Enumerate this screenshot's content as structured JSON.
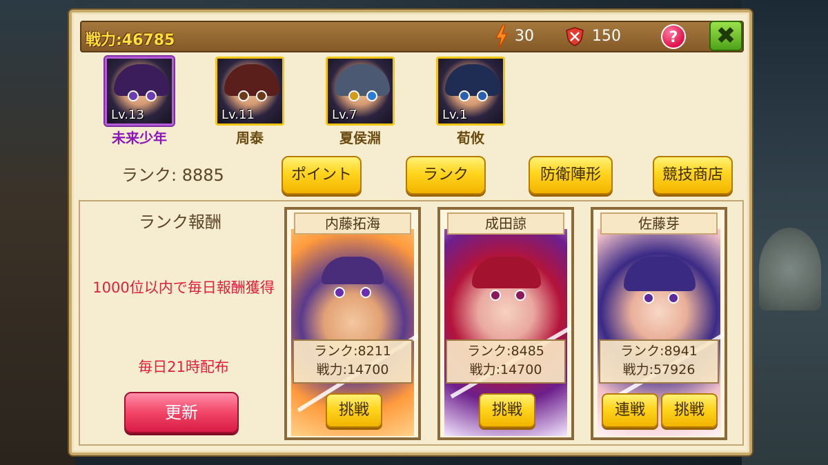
{
  "header": {
    "power_label": "戦力:46785",
    "energy": "30",
    "tickets": "150",
    "help_label": "?",
    "close_label": "✖"
  },
  "heroes": [
    {
      "level": "Lv.13",
      "name": "未来少年",
      "selected": true
    },
    {
      "level": "Lv.11",
      "name": "周泰",
      "selected": false
    },
    {
      "level": "Lv.7",
      "name": "夏侯淵",
      "selected": false
    },
    {
      "level": "Lv.1",
      "name": "荀攸",
      "selected": false
    }
  ],
  "rank_text": "ランク: 8885",
  "tabs": [
    "ポイント",
    "ランク",
    "防衛陣形",
    "競技商店"
  ],
  "rewards": {
    "title": "ランク報酬",
    "desc": "1000位以内で毎日報酬獲得",
    "time": "毎日21時配布",
    "refresh_label": "更新"
  },
  "opponents": [
    {
      "name": "内藤拓海",
      "rank": "ランク:8211",
      "power": "戦力:14700",
      "buttons": [
        "挑戦"
      ]
    },
    {
      "name": "成田諒",
      "rank": "ランク:8485",
      "power": "戦力:14700",
      "buttons": [
        "挑戦"
      ]
    },
    {
      "name": "佐藤芽",
      "rank": "ランク:8941",
      "power": "戦力:57926",
      "buttons": [
        "連戦",
        "挑戦"
      ]
    }
  ]
}
